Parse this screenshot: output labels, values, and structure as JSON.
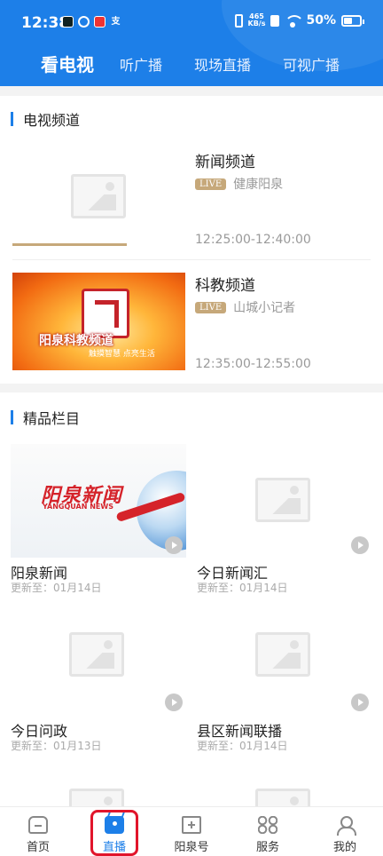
{
  "status_bar": {
    "time": "12:38",
    "net_speed_value": "465",
    "net_speed_unit": "KB/s",
    "battery": "50%"
  },
  "top_tabs": [
    {
      "label": "看电视",
      "active": true
    },
    {
      "label": "听广播",
      "active": false
    },
    {
      "label": "现场直播",
      "active": false
    },
    {
      "label": "可视广播",
      "active": false
    }
  ],
  "tv_section": {
    "title": "电视频道",
    "channels": [
      {
        "name": "新闻频道",
        "live": "LIVE",
        "program": "健康阳泉",
        "time": "12:25:00-12:40:00",
        "progress": 0.66
      },
      {
        "name": "科教频道",
        "live": "LIVE",
        "program": "山城小记者",
        "time": "12:35:00-12:55:00",
        "thumb_title": "阳泉科教频道",
        "thumb_sub": "触摸智慧 点亮生活"
      }
    ]
  },
  "featured_section": {
    "title": "精品栏目",
    "programs": [
      {
        "name": "阳泉新闻",
        "updated": "更新至：01月14日",
        "thumb_title": "阳泉新闻",
        "thumb_en": "YANGQUAN NEWS"
      },
      {
        "name": "今日新闻汇",
        "updated": "更新至：01月14日"
      },
      {
        "name": "今日问政",
        "updated": "更新至：01月13日"
      },
      {
        "name": "县区新闻联播",
        "updated": "更新至：01月14日"
      }
    ]
  },
  "bottom_nav": [
    {
      "label": "首页",
      "icon": "home-icon"
    },
    {
      "label": "直播",
      "icon": "live-tv-icon",
      "active": true
    },
    {
      "label": "阳泉号",
      "icon": "add-account-icon"
    },
    {
      "label": "服务",
      "icon": "service-grid-icon"
    },
    {
      "label": "我的",
      "icon": "profile-icon"
    }
  ],
  "colors": {
    "brand_blue": "#1d7fe8",
    "live_gold": "#c6a87a",
    "highlight_red": "#e1152b"
  }
}
